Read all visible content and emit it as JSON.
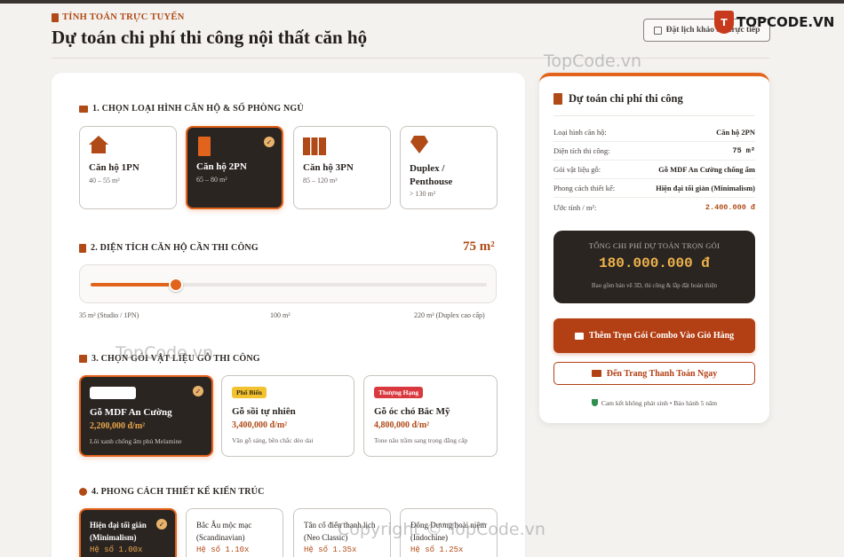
{
  "header": {
    "eyebrow": "TÍNH TOÁN TRỰC TUYẾN",
    "title": "Dự toán chi phí thi công nội thất căn hộ",
    "book_button": "Đặt lịch khảo sát trực tiếp"
  },
  "watermark": {
    "logo_text": "TOPCODE.VN",
    "texts": [
      "TopCode.vn",
      "TopCode.vn",
      "Copyright © TopCode.vn"
    ]
  },
  "sections": {
    "s1_title": "1. CHỌN LOẠI HÌNH CĂN HỘ & SỐ PHÒNG NGỦ",
    "s2_title": "2. DIỆN TÍCH CĂN HỘ CẦN THI CÔNG",
    "s3_title": "3. CHỌN GÓI VẬT LIỆU GỖ THI CÔNG",
    "s4_title": "4. PHONG CÁCH THIẾT KẾ KIẾN TRÚC"
  },
  "apartments": [
    {
      "name": "Căn hộ 1PN",
      "range": "40 – 55 m²",
      "icon": "house-icon",
      "selected": false
    },
    {
      "name": "Căn hộ 2PN",
      "range": "65 – 80 m²",
      "icon": "building-icon",
      "selected": true
    },
    {
      "name": "Căn hộ 3PN",
      "range": "85 – 120 m²",
      "icon": "city-icon",
      "selected": false
    },
    {
      "name": "Duplex / Penthouse",
      "range": "> 130 m²",
      "icon": "gem-icon",
      "selected": false
    }
  ],
  "area": {
    "value_label": "75 m²",
    "value": 75,
    "min": 35,
    "max": 220,
    "ticks": [
      "35 m² (Studio / 1PN)",
      "100 m²",
      "220 m² (Duplex cao cấp)"
    ]
  },
  "materials": [
    {
      "tag": "",
      "name": "Gỗ MDF An Cường",
      "price": "2,200,000 đ/m²",
      "desc": "Lõi xanh chống ẩm phủ Melamine",
      "selected": true,
      "tag_color": "#ffffff"
    },
    {
      "tag": "Phổ Biến",
      "name": "Gỗ sồi tự nhiên",
      "price": "3,400,000 đ/m²",
      "desc": "Vân gỗ sáng, bền chắc dẻo dai",
      "selected": false,
      "tag_color": "#f2c230"
    },
    {
      "tag": "Thượng Hạng",
      "name": "Gỗ óc chó Bắc Mỹ",
      "price": "4,800,000 đ/m²",
      "desc": "Tone nâu trầm sang trọng đẳng cấp",
      "selected": false,
      "tag_color": "#d9383f"
    }
  ],
  "styles": [
    {
      "name": "Hiện đại tối giản (Minimalism)",
      "coef": "Hệ số 1.00x",
      "selected": true
    },
    {
      "name": "Bắc Âu mộc mạc (Scandinavian)",
      "coef": "Hệ số 1.10x",
      "selected": false
    },
    {
      "name": "Tân cổ điển thanh lịch (Neo Classic)",
      "coef": "Hệ số 1.35x",
      "selected": false
    },
    {
      "name": "Đông Dương hoài niệm (Indochine)",
      "coef": "Hệ số 1.25x",
      "selected": false
    }
  ],
  "summary": {
    "title": "Dự toán chi phí thi công",
    "rows": [
      {
        "k": "Loại hình căn hộ:",
        "v": "Căn hộ 2PN"
      },
      {
        "k": "Diện tích thi công:",
        "v": "75 m²"
      },
      {
        "k": "Gói vật liệu gỗ:",
        "v": "Gỗ MDF An Cường chống ẩm"
      },
      {
        "k": "Phong cách thiết kế:",
        "v": "Hiện đại tối giản (Minimalism)"
      },
      {
        "k": "Ước tính / m²:",
        "v": "2.400.000 đ"
      }
    ],
    "total_label": "TỔNG CHI PHÍ DỰ TOÁN TRỌN GÓI",
    "total_value": "180.000.000 đ",
    "total_note": "Bao gồm bản vẽ 3D, thi công & lắp đặt hoàn thiện",
    "add_cart": "Thêm Trọn Gói Combo Vào Giỏ Hàng",
    "checkout": "Đến Trang Thanh Toán Ngay",
    "guarantee": "Cam kết không phát sinh • Bảo hành 5 năm"
  },
  "colors": {
    "accent": "#e2631c",
    "brand_dark": "#2b2522",
    "brand_rust": "#b33f14"
  }
}
